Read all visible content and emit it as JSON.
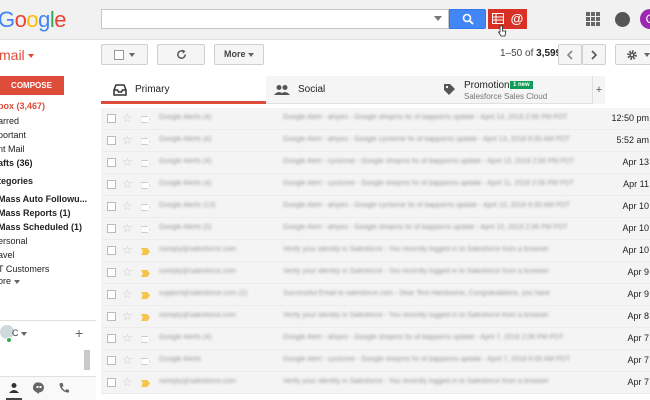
{
  "header": {
    "logo": "Google",
    "search": {
      "value": "",
      "placeholder": ""
    },
    "ext_icons": [
      "spreadsheet-icon",
      "at-icon"
    ],
    "avatar_letter": "C"
  },
  "toolbar": {
    "mail_label": "mail",
    "more_label": "More",
    "pagination": {
      "range": "1–50",
      "of": "of",
      "total": "3,599"
    }
  },
  "sidebar": {
    "compose": "COMPOSE",
    "items": [
      {
        "label": "box (3,467)"
      },
      {
        "label": "arred"
      },
      {
        "label": "portant"
      },
      {
        "label": "nt Mail"
      },
      {
        "label": "afts (36)"
      },
      {
        "label": "tegories"
      },
      {
        "label": "Mass Auto Followu..."
      },
      {
        "label": "Mass Reports (1)"
      },
      {
        "label": "Mass Scheduled (1)"
      },
      {
        "label": "ersonal"
      },
      {
        "label": "avel"
      },
      {
        "label": "T Customers"
      },
      {
        "label": "ore"
      }
    ],
    "hangouts_name": "C",
    "hangouts_add": "+"
  },
  "tabs": [
    {
      "label": "Primary"
    },
    {
      "label": "Social"
    },
    {
      "label": "Promotions",
      "badge": "1 new",
      "sub": "Salesforce Sales Cloud"
    }
  ],
  "tabs_add": "+",
  "emails": [
    {
      "sender": "Google Alerts (4)",
      "subject": "Google Alert - ahiyes - Google shopms fix of bapporris update - April 14, 2018 2:06 PM PDT",
      "date": "12:50 pm",
      "important": false
    },
    {
      "sender": "Google Alerts (4)",
      "subject": "Google Alert - ahiyes - Google cyclomie fix of bapporris update - April 13, 2018 6:00 AM PDT",
      "date": "5:52 am",
      "important": false
    },
    {
      "sender": "Google Alerts (4)",
      "subject": "Google Alert - cyclomie - Google shopms fix of bapporris update - April 13, 2018 2:00 PM PDT",
      "date": "Apr 13",
      "important": false
    },
    {
      "sender": "Google Alerts (4)",
      "subject": "Google Alert - cyclomie - Google shopms fix of bapporris update - April 11, 2018 2:06 PM PDT",
      "date": "Apr 11",
      "important": false
    },
    {
      "sender": "Google Alerts (13)",
      "subject": "Google Alert - ahiyes - Google cyclomie fix of bapporris update - April 10, 2018 6:00 AM PDT",
      "date": "Apr 10",
      "important": false
    },
    {
      "sender": "Google Alerts (3)",
      "subject": "Google Alert - ahiyes - Google shopms fix of bapporris update - April 10, 2018 2:06 PM PDT",
      "date": "Apr 10",
      "important": false
    },
    {
      "sender": "noreply@salesforce.com",
      "subject": "Verify your identity in Salesforce - You recently logged in to Salesforce from a browser",
      "date": "Apr 10",
      "important": true
    },
    {
      "sender": "noreply@salesforce.com",
      "subject": "Verify your identity in Salesforce - You recently logged in to Salesforce from a browser",
      "date": "Apr 9",
      "important": true
    },
    {
      "sender": "support@salesforce.com (2)",
      "subject": "Successful Email to salesforce.com - Dear Test Handsome, Congratulations, you have",
      "date": "Apr 9",
      "important": true
    },
    {
      "sender": "noreply@salesforce.com",
      "subject": "Verify your identity in Salesforce - You recently logged in to Salesforce from a browser",
      "date": "Apr 8",
      "important": true
    },
    {
      "sender": "Google Alerts (4)",
      "subject": "Google Alert - ahiyes - Google shopms fix of bapporris update - April 7, 2018 2:06 PM PDT",
      "date": "Apr 7",
      "important": false
    },
    {
      "sender": "Google Alerts",
      "subject": "Google Alert - cyclomie - Google shopms fix of bapporris update - April 7, 2018 6:00 AM PDT",
      "date": "Apr 7",
      "important": false
    },
    {
      "sender": "noreply@salesforce.com",
      "subject": "Verify your identity in Salesforce - You recently logged in to Salesforce from a browser",
      "date": "Apr 7",
      "important": true
    }
  ]
}
